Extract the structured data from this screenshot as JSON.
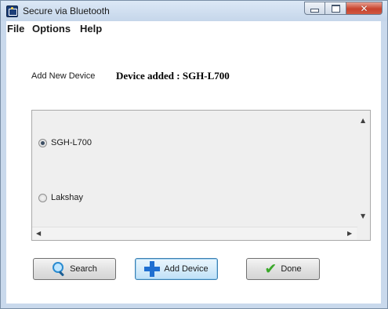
{
  "window": {
    "title": "Secure via Bluetooth",
    "close_glyph": "✕"
  },
  "menu": {
    "items": [
      "File",
      "Options",
      "Help"
    ]
  },
  "content": {
    "add_label": "Add New Device",
    "status": "Device added : SGH-L700"
  },
  "devices": [
    {
      "label": "SGH-L700",
      "selected": true
    },
    {
      "label": "Lakshay",
      "selected": false
    }
  ],
  "buttons": {
    "search": {
      "label": "Search",
      "icon": "search-icon"
    },
    "add": {
      "label": "Add Device",
      "icon": "plus-icon"
    },
    "done": {
      "label": "Done",
      "icon": "check-icon",
      "glyph": "✔"
    }
  },
  "scroll_glyphs": {
    "up": "▲",
    "down": "▼",
    "left": "◀",
    "right": "▶"
  },
  "colors": {
    "accent": "#1f6fd1",
    "check": "#3aa82a",
    "close": "#c8432d"
  }
}
